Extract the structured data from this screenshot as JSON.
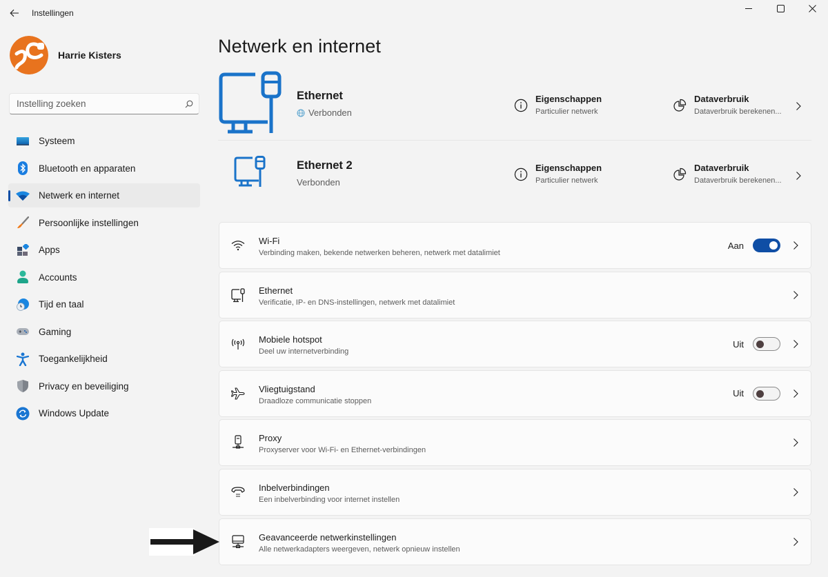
{
  "window": {
    "title": "Instellingen",
    "controls": {
      "minimize": "minimize-icon",
      "maximize": "maximize-icon",
      "close": "close-icon"
    }
  },
  "profile": {
    "name": "Harrie Kisters",
    "avatar_colors": {
      "primary": "#e8731e",
      "accent": "#ffffff"
    }
  },
  "search": {
    "placeholder": "Instelling zoeken",
    "value": ""
  },
  "sidebar": {
    "items": [
      {
        "label": "Systeem",
        "icon": "system-icon",
        "active": false
      },
      {
        "label": "Bluetooth en apparaten",
        "icon": "bluetooth-icon",
        "active": false
      },
      {
        "label": "Netwerk en internet",
        "icon": "network-icon",
        "active": true
      },
      {
        "label": "Persoonlijke instellingen",
        "icon": "brush-icon",
        "active": false
      },
      {
        "label": "Apps",
        "icon": "apps-icon",
        "active": false
      },
      {
        "label": "Accounts",
        "icon": "account-icon",
        "active": false
      },
      {
        "label": "Tijd en taal",
        "icon": "time-language-icon",
        "active": false
      },
      {
        "label": "Gaming",
        "icon": "gamepad-icon",
        "active": false
      },
      {
        "label": "Toegankelijkheid",
        "icon": "accessibility-icon",
        "active": false
      },
      {
        "label": "Privacy en beveiliging",
        "icon": "shield-icon",
        "active": false
      },
      {
        "label": "Windows Update",
        "icon": "update-icon",
        "active": false
      }
    ]
  },
  "main": {
    "title": "Netwerk en internet",
    "connections": [
      {
        "name": "Ethernet",
        "status": "Verbonden",
        "status_icon": "globe-icon",
        "properties": {
          "title": "Eigenschappen",
          "subtitle": "Particulier netwerk"
        },
        "data_usage": {
          "title": "Dataverbruik",
          "subtitle": "Dataverbruik berekenen..."
        }
      },
      {
        "name": "Ethernet 2",
        "status": "Verbonden",
        "properties": {
          "title": "Eigenschappen",
          "subtitle": "Particulier netwerk"
        },
        "data_usage": {
          "title": "Dataverbruik",
          "subtitle": "Dataverbruik berekenen..."
        }
      }
    ],
    "settings": [
      {
        "title": "Wi-Fi",
        "subtitle": "Verbinding maken, bekende netwerken beheren, netwerk met datalimiet",
        "icon": "wifi-icon",
        "toggle": true,
        "state": "Aan",
        "on": true
      },
      {
        "title": "Ethernet",
        "subtitle": "Verificatie, IP- en DNS-instellingen, netwerk met datalimiet",
        "icon": "ethernet-icon",
        "toggle": false
      },
      {
        "title": "Mobiele hotspot",
        "subtitle": "Deel uw internetverbinding",
        "icon": "hotspot-icon",
        "toggle": true,
        "state": "Uit",
        "on": false
      },
      {
        "title": "Vliegtuigstand",
        "subtitle": "Draadloze communicatie stoppen",
        "icon": "airplane-icon",
        "toggle": true,
        "state": "Uit",
        "on": false
      },
      {
        "title": "Proxy",
        "subtitle": "Proxyserver voor Wi-Fi- en Ethernet-verbindingen",
        "icon": "proxy-icon",
        "toggle": false
      },
      {
        "title": "Inbelverbindingen",
        "subtitle": "Een inbelverbinding voor internet instellen",
        "icon": "dialup-icon",
        "toggle": false
      },
      {
        "title": "Geavanceerde netwerkinstellingen",
        "subtitle": "Alle netwerkadapters weergeven, netwerk opnieuw instellen",
        "icon": "advanced-network-icon",
        "toggle": false
      }
    ]
  },
  "annotation": {
    "arrow_target": "Geavanceerde netwerkinstellingen"
  },
  "colors": {
    "accent": "#0f4ea5",
    "icon_blue": "#1a73c9",
    "background": "#f3f3f3",
    "card": "#fbfbfb"
  }
}
